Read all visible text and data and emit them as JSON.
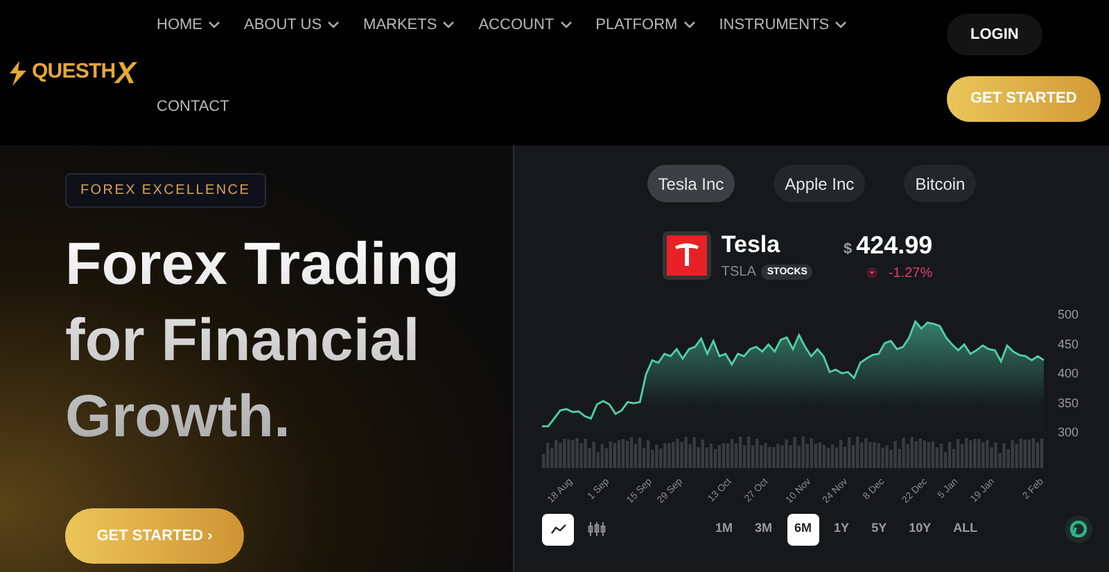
{
  "logo": {
    "text": "QUESTH",
    "mark": "X"
  },
  "nav": [
    {
      "label": "HOME",
      "dropdown": true
    },
    {
      "label": "ABOUT US",
      "dropdown": true
    },
    {
      "label": "MARKETS",
      "dropdown": true
    },
    {
      "label": "ACCOUNT",
      "dropdown": true
    },
    {
      "label": "PLATFORM",
      "dropdown": true
    },
    {
      "label": "INSTRUMENTS",
      "dropdown": true
    },
    {
      "label": "CONTACT",
      "dropdown": false
    }
  ],
  "header_buttons": {
    "login": "LOGIN",
    "get_started": "GET STARTED"
  },
  "hero": {
    "badge": "FOREX EXCELLENCE",
    "headline": [
      "Forex Trading",
      "for Financial",
      "Growth."
    ],
    "button": "GET STARTED ›"
  },
  "widget": {
    "tabs": [
      {
        "label": "Tesla Inc",
        "selected": true
      },
      {
        "label": "Apple Inc",
        "selected": false
      },
      {
        "label": "Bitcoin",
        "selected": false
      }
    ],
    "stock": {
      "name": "Tesla",
      "ticker": "TSLA",
      "type": "STOCKS",
      "currency": "$",
      "price": "424.99",
      "change": "-1.27%",
      "falling": true
    },
    "chart_data": {
      "type": "area",
      "ylim": [
        300,
        500
      ],
      "yticks": [
        300,
        350,
        400,
        450,
        500
      ],
      "categories": [
        null,
        null,
        null,
        null,
        null,
        "18 Aug",
        null,
        null,
        null,
        null,
        null,
        "1 Sep",
        null,
        null,
        null,
        null,
        null,
        null,
        "15 Sep",
        null,
        null,
        null,
        null,
        "29 Sep",
        null,
        null,
        null,
        null,
        null,
        null,
        null,
        "13 Oct",
        null,
        null,
        null,
        null,
        null,
        "27 Oct",
        null,
        null,
        null,
        null,
        null,
        null,
        "10 Nov",
        null,
        null,
        null,
        null,
        null,
        "24 Nov",
        null,
        null,
        null,
        null,
        null,
        "8 Dec",
        null,
        null,
        null,
        null,
        null,
        null,
        "22 Dec",
        null,
        null,
        null,
        null,
        "5 Jan",
        null,
        null,
        null,
        null,
        null,
        "19 Jan",
        null,
        null,
        null,
        null,
        null,
        null,
        null,
        "2 Feb"
      ],
      "series": [
        {
          "color": "#4fd1a5",
          "values": [
            310,
            310,
            323,
            337,
            339,
            334,
            335,
            327,
            323,
            347,
            353,
            347,
            331,
            337,
            351,
            349,
            351,
            398,
            422,
            418,
            433,
            429,
            441,
            425,
            441,
            445,
            459,
            433,
            455,
            429,
            433,
            415,
            433,
            429,
            441,
            445,
            437,
            449,
            437,
            457,
            461,
            441,
            465,
            445,
            429,
            441,
            429,
            402,
            406,
            400,
            402,
            392,
            418,
            425,
            431,
            433,
            451,
            455,
            441,
            445,
            461,
            488,
            476,
            486,
            484,
            480,
            461,
            449,
            439,
            449,
            433,
            439,
            447,
            441,
            439,
            420,
            447,
            437,
            431,
            429,
            422,
            429,
            422
          ]
        }
      ]
    },
    "chart_types": [
      {
        "kind": "line",
        "selected": true
      },
      {
        "kind": "candles",
        "selected": false
      }
    ],
    "ranges": [
      {
        "label": "1M",
        "selected": false
      },
      {
        "label": "3M",
        "selected": false
      },
      {
        "label": "6M",
        "selected": true
      },
      {
        "label": "1Y",
        "selected": false
      },
      {
        "label": "5Y",
        "selected": false
      },
      {
        "label": "10Y",
        "selected": false
      },
      {
        "label": "ALL",
        "selected": false
      }
    ]
  }
}
